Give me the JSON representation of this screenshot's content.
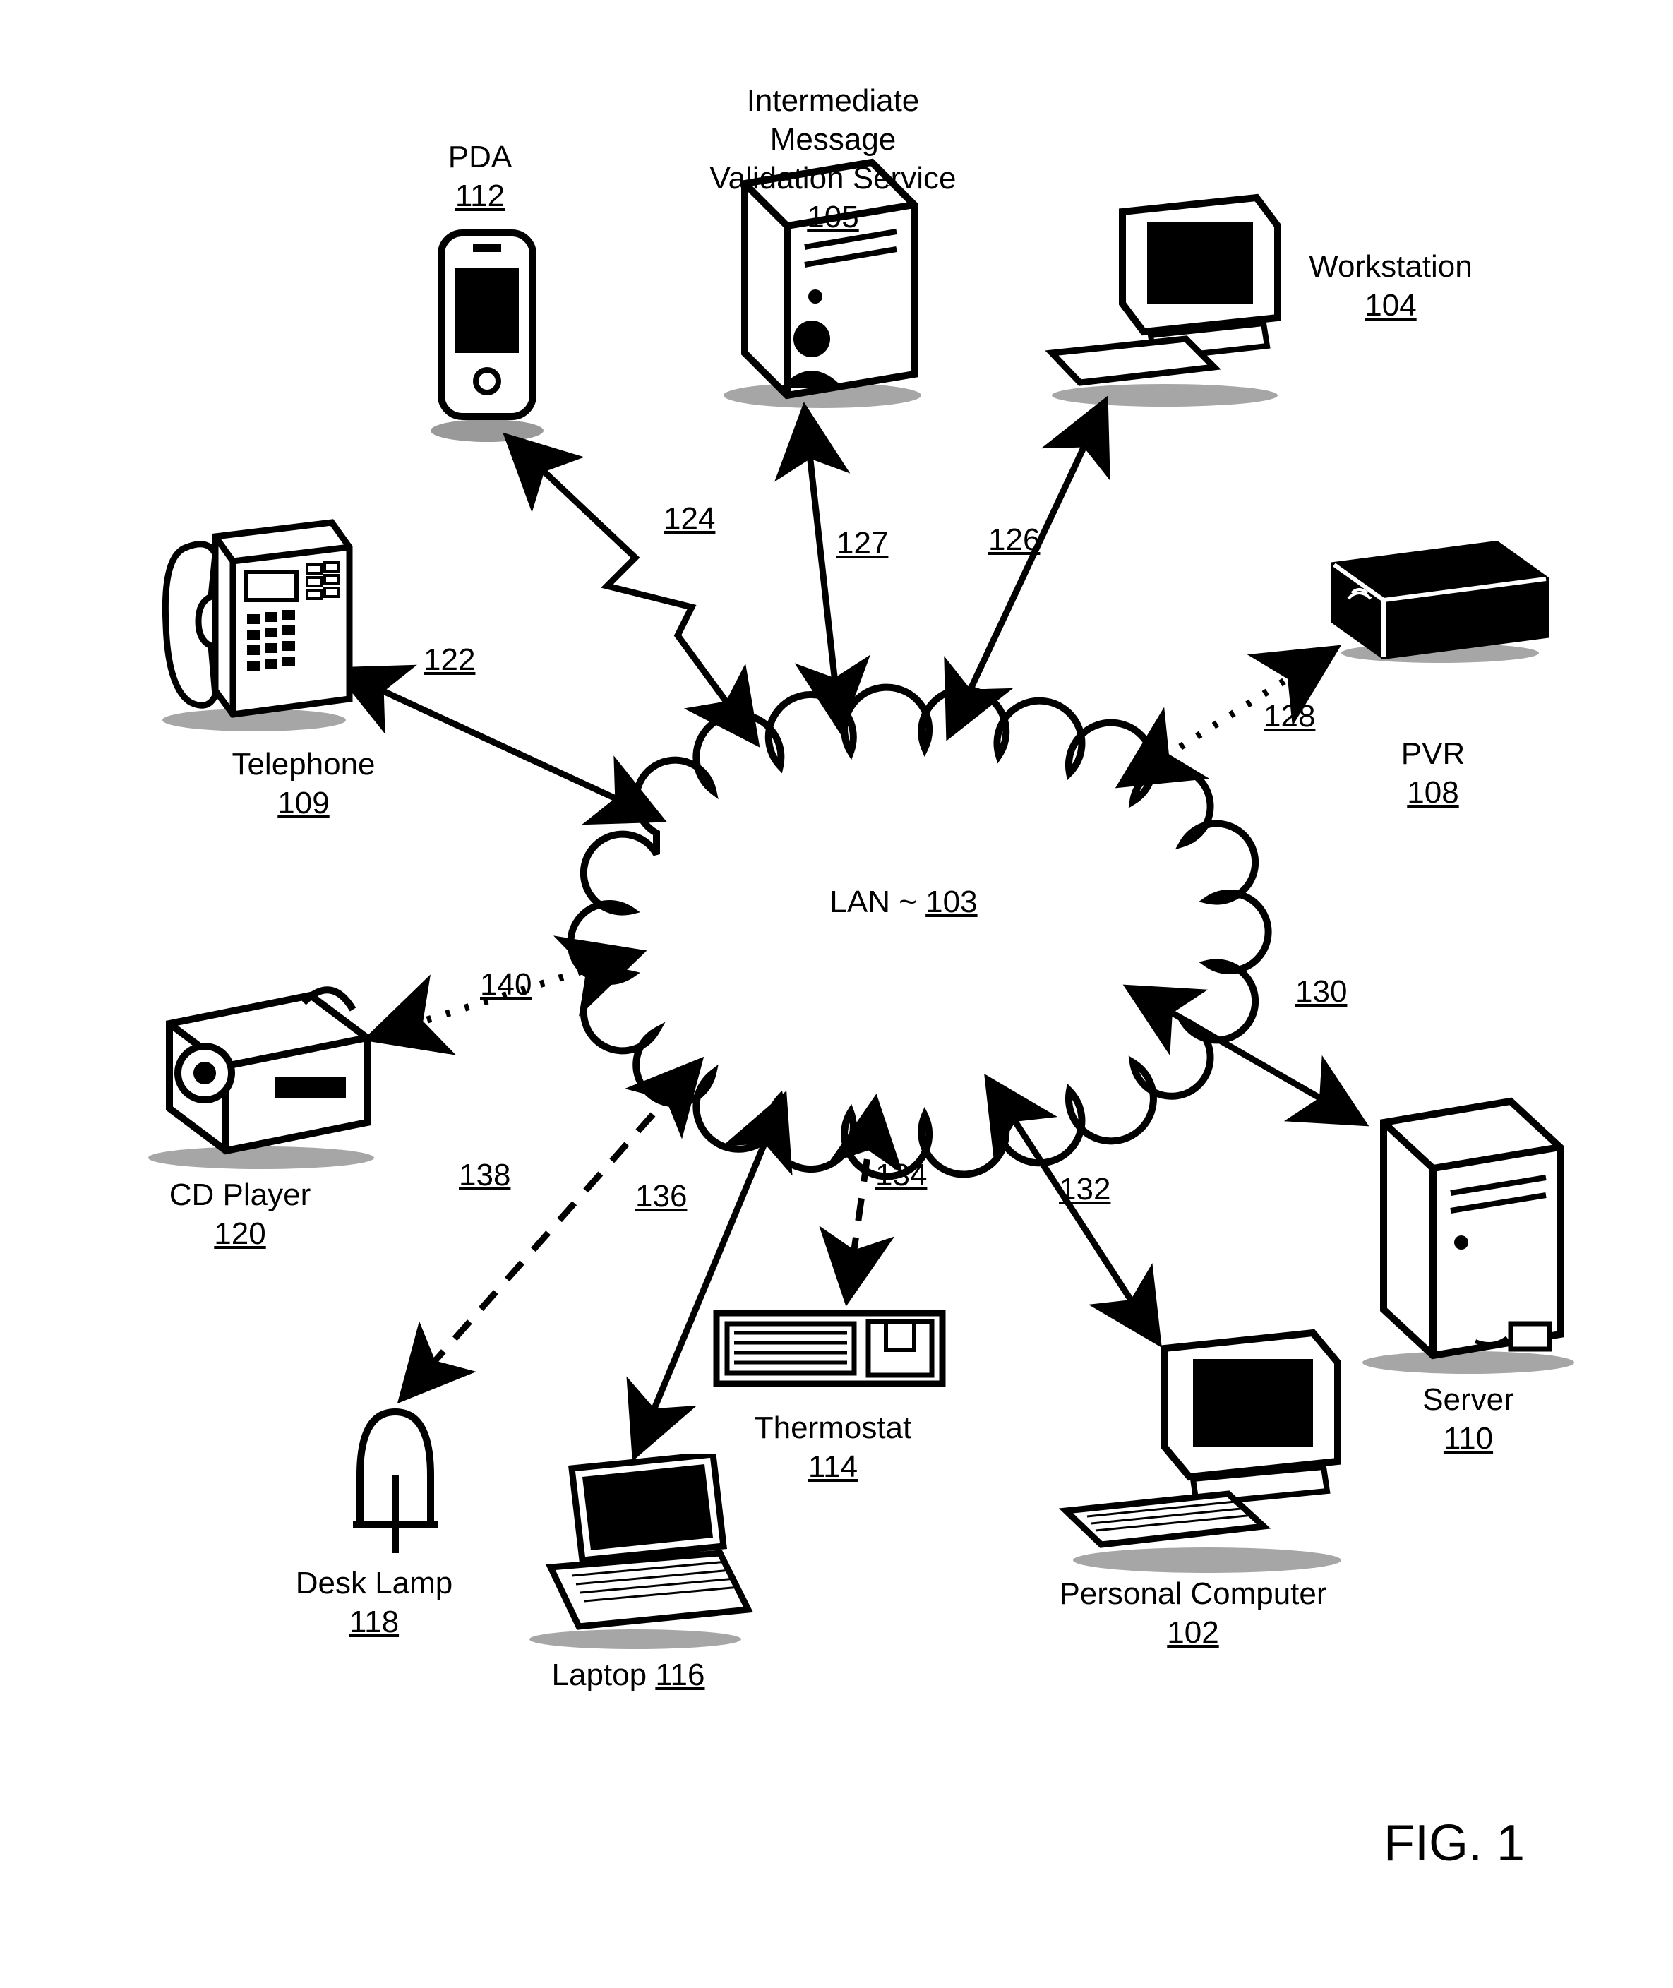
{
  "figure_label": "FIG. 1",
  "center": {
    "label": "LAN ~",
    "ref": "103"
  },
  "nodes": {
    "pda": {
      "label": "PDA",
      "ref": "112"
    },
    "imvs": {
      "label": "Intermediate Message\nValidation Service",
      "ref": "105"
    },
    "workstation": {
      "label": "Workstation",
      "ref": "104"
    },
    "pvr": {
      "label": "PVR",
      "ref": "108"
    },
    "server": {
      "label": "Server",
      "ref": "110"
    },
    "pc": {
      "label": "Personal Computer",
      "ref": "102"
    },
    "thermostat": {
      "label": "Thermostat",
      "ref": "114"
    },
    "laptop": {
      "label": "Laptop",
      "ref": "116"
    },
    "desklamp": {
      "label": "Desk Lamp",
      "ref": "118"
    },
    "cdplayer": {
      "label": "CD Player",
      "ref": "120"
    },
    "telephone": {
      "label": "Telephone",
      "ref": "109"
    }
  },
  "edges": {
    "e122": "122",
    "e124": "124",
    "e126": "126",
    "e127": "127",
    "e128": "128",
    "e130": "130",
    "e132": "132",
    "e134": "134",
    "e136": "136",
    "e138": "138",
    "e140": "140"
  }
}
